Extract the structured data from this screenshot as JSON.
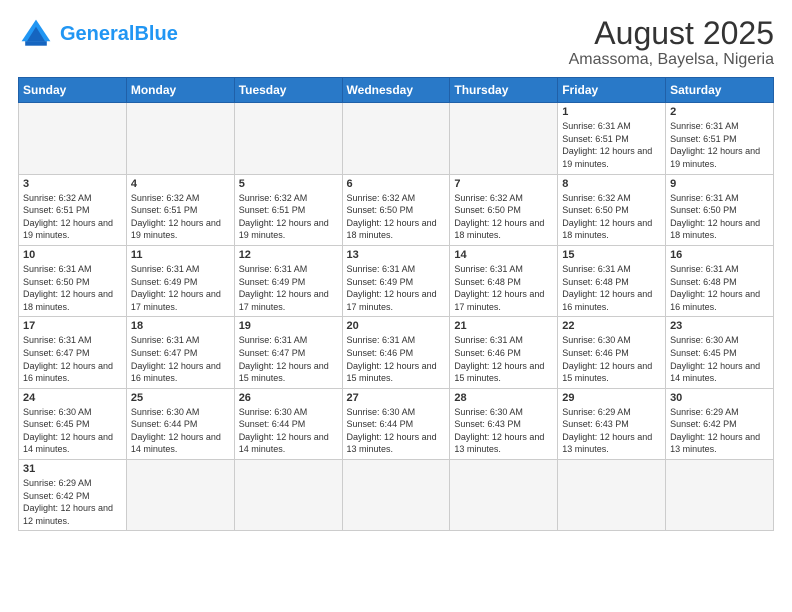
{
  "header": {
    "logo_general": "General",
    "logo_blue": "Blue",
    "title": "August 2025",
    "subtitle": "Amassoma, Bayelsa, Nigeria"
  },
  "days_of_week": [
    "Sunday",
    "Monday",
    "Tuesday",
    "Wednesday",
    "Thursday",
    "Friday",
    "Saturday"
  ],
  "weeks": [
    [
      {
        "day": "",
        "info": ""
      },
      {
        "day": "",
        "info": ""
      },
      {
        "day": "",
        "info": ""
      },
      {
        "day": "",
        "info": ""
      },
      {
        "day": "",
        "info": ""
      },
      {
        "day": "1",
        "info": "Sunrise: 6:31 AM\nSunset: 6:51 PM\nDaylight: 12 hours and 19 minutes."
      },
      {
        "day": "2",
        "info": "Sunrise: 6:31 AM\nSunset: 6:51 PM\nDaylight: 12 hours and 19 minutes."
      }
    ],
    [
      {
        "day": "3",
        "info": "Sunrise: 6:32 AM\nSunset: 6:51 PM\nDaylight: 12 hours and 19 minutes."
      },
      {
        "day": "4",
        "info": "Sunrise: 6:32 AM\nSunset: 6:51 PM\nDaylight: 12 hours and 19 minutes."
      },
      {
        "day": "5",
        "info": "Sunrise: 6:32 AM\nSunset: 6:51 PM\nDaylight: 12 hours and 19 minutes."
      },
      {
        "day": "6",
        "info": "Sunrise: 6:32 AM\nSunset: 6:50 PM\nDaylight: 12 hours and 18 minutes."
      },
      {
        "day": "7",
        "info": "Sunrise: 6:32 AM\nSunset: 6:50 PM\nDaylight: 12 hours and 18 minutes."
      },
      {
        "day": "8",
        "info": "Sunrise: 6:32 AM\nSunset: 6:50 PM\nDaylight: 12 hours and 18 minutes."
      },
      {
        "day": "9",
        "info": "Sunrise: 6:31 AM\nSunset: 6:50 PM\nDaylight: 12 hours and 18 minutes."
      }
    ],
    [
      {
        "day": "10",
        "info": "Sunrise: 6:31 AM\nSunset: 6:50 PM\nDaylight: 12 hours and 18 minutes."
      },
      {
        "day": "11",
        "info": "Sunrise: 6:31 AM\nSunset: 6:49 PM\nDaylight: 12 hours and 17 minutes."
      },
      {
        "day": "12",
        "info": "Sunrise: 6:31 AM\nSunset: 6:49 PM\nDaylight: 12 hours and 17 minutes."
      },
      {
        "day": "13",
        "info": "Sunrise: 6:31 AM\nSunset: 6:49 PM\nDaylight: 12 hours and 17 minutes."
      },
      {
        "day": "14",
        "info": "Sunrise: 6:31 AM\nSunset: 6:48 PM\nDaylight: 12 hours and 17 minutes."
      },
      {
        "day": "15",
        "info": "Sunrise: 6:31 AM\nSunset: 6:48 PM\nDaylight: 12 hours and 16 minutes."
      },
      {
        "day": "16",
        "info": "Sunrise: 6:31 AM\nSunset: 6:48 PM\nDaylight: 12 hours and 16 minutes."
      }
    ],
    [
      {
        "day": "17",
        "info": "Sunrise: 6:31 AM\nSunset: 6:47 PM\nDaylight: 12 hours and 16 minutes."
      },
      {
        "day": "18",
        "info": "Sunrise: 6:31 AM\nSunset: 6:47 PM\nDaylight: 12 hours and 16 minutes."
      },
      {
        "day": "19",
        "info": "Sunrise: 6:31 AM\nSunset: 6:47 PM\nDaylight: 12 hours and 15 minutes."
      },
      {
        "day": "20",
        "info": "Sunrise: 6:31 AM\nSunset: 6:46 PM\nDaylight: 12 hours and 15 minutes."
      },
      {
        "day": "21",
        "info": "Sunrise: 6:31 AM\nSunset: 6:46 PM\nDaylight: 12 hours and 15 minutes."
      },
      {
        "day": "22",
        "info": "Sunrise: 6:30 AM\nSunset: 6:46 PM\nDaylight: 12 hours and 15 minutes."
      },
      {
        "day": "23",
        "info": "Sunrise: 6:30 AM\nSunset: 6:45 PM\nDaylight: 12 hours and 14 minutes."
      }
    ],
    [
      {
        "day": "24",
        "info": "Sunrise: 6:30 AM\nSunset: 6:45 PM\nDaylight: 12 hours and 14 minutes."
      },
      {
        "day": "25",
        "info": "Sunrise: 6:30 AM\nSunset: 6:44 PM\nDaylight: 12 hours and 14 minutes."
      },
      {
        "day": "26",
        "info": "Sunrise: 6:30 AM\nSunset: 6:44 PM\nDaylight: 12 hours and 14 minutes."
      },
      {
        "day": "27",
        "info": "Sunrise: 6:30 AM\nSunset: 6:44 PM\nDaylight: 12 hours and 13 minutes."
      },
      {
        "day": "28",
        "info": "Sunrise: 6:30 AM\nSunset: 6:43 PM\nDaylight: 12 hours and 13 minutes."
      },
      {
        "day": "29",
        "info": "Sunrise: 6:29 AM\nSunset: 6:43 PM\nDaylight: 12 hours and 13 minutes."
      },
      {
        "day": "30",
        "info": "Sunrise: 6:29 AM\nSunset: 6:42 PM\nDaylight: 12 hours and 13 minutes."
      }
    ],
    [
      {
        "day": "31",
        "info": "Sunrise: 6:29 AM\nSunset: 6:42 PM\nDaylight: 12 hours and 12 minutes."
      },
      {
        "day": "",
        "info": ""
      },
      {
        "day": "",
        "info": ""
      },
      {
        "day": "",
        "info": ""
      },
      {
        "day": "",
        "info": ""
      },
      {
        "day": "",
        "info": ""
      },
      {
        "day": "",
        "info": ""
      }
    ]
  ]
}
